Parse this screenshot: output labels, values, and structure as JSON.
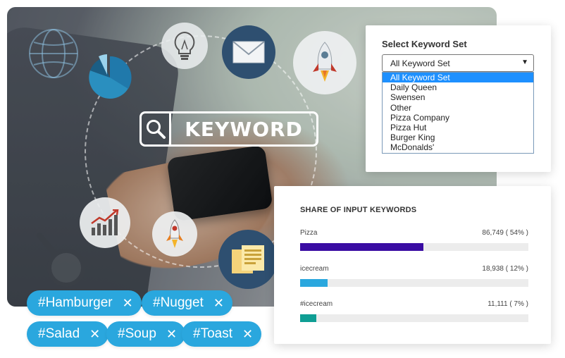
{
  "hero": {
    "keyword_text": "KEYWORD"
  },
  "chips": [
    {
      "label": "#Hamburger"
    },
    {
      "label": "#Nugget"
    },
    {
      "label": "#Salad"
    },
    {
      "label": "#Soup"
    },
    {
      "label": "#Toast"
    }
  ],
  "chip_remove_glyph": "✕",
  "keyword_set": {
    "title": "Select Keyword Set",
    "selected": "All Keyword Set",
    "options": [
      "All Keyword Set",
      "Daily Queen",
      "Swensen",
      "Other",
      "Pizza Company",
      "Pizza Hut",
      "Burger King",
      "McDonalds'"
    ]
  },
  "share": {
    "title": "SHARE OF INPUT KEYWORDS",
    "rows": [
      {
        "label": "Pizza",
        "value": "86,749 ( 54% )",
        "percent": 54,
        "color": "#3a0ca3"
      },
      {
        "label": "icecream",
        "value": "18,938 ( 12% )",
        "percent": 12,
        "color": "#2aa7de"
      },
      {
        "label": "#icecream",
        "value": "11,111 ( 7% )",
        "percent": 7,
        "color": "#0f9e94"
      }
    ]
  },
  "colors": {
    "chip": "#2aa7de",
    "dropdown_highlight": "#1e90ff"
  },
  "icons": [
    "globe-icon",
    "pie-chart-icon",
    "lightbulb-icon",
    "mail-icon",
    "rocket-icon",
    "search-icon",
    "bar-growth-icon",
    "rocket-launch-icon",
    "document-icon",
    "magnifier-icon"
  ]
}
